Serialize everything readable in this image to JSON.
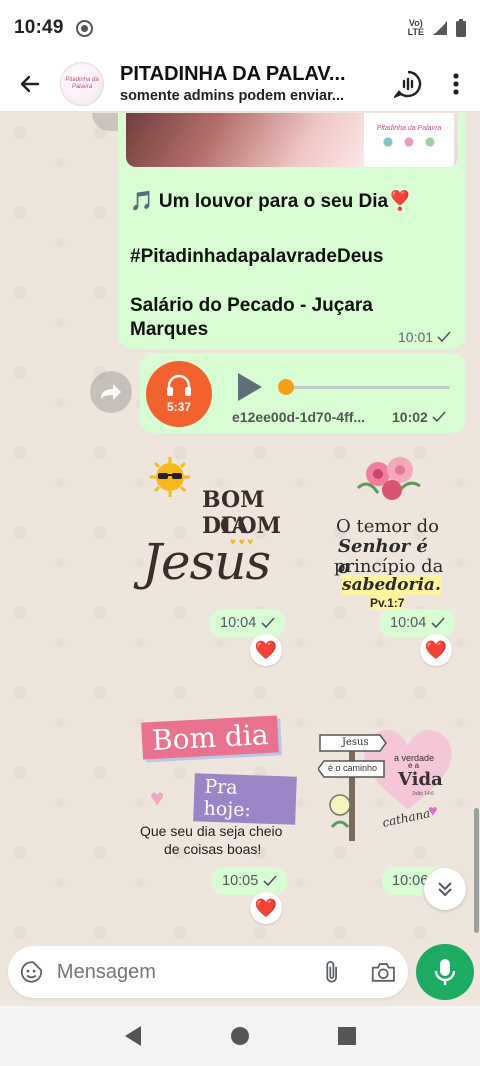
{
  "status_bar": {
    "time": "10:49",
    "volte_top": "Vo)",
    "volte_bottom": "LTE"
  },
  "header": {
    "title": "PITADINHA DA PALAV...",
    "subtitle": "somente admins podem enviar...",
    "avatar_text": "Pitadinha da Palavra"
  },
  "messages": {
    "image_card_text": "Pitadinha da Palavra",
    "text_line1": "🎵 Um louvor para o seu Dia❣️",
    "text_line2": "#PitadinhadapalavradeDeus",
    "text_line3": "Salário do Pecado - Juçara",
    "text_line4": "Marques",
    "text_time": "10:01",
    "audio_duration": "5:37",
    "audio_progress": 0.0,
    "audio_filename": "e12ee00d-1d70-4ff...",
    "audio_time": "10:02",
    "sticker1_line1": "BOM DIA",
    "sticker1_line2": "COM",
    "sticker1_line3": "Jesus",
    "sticker1_time": "10:04",
    "sticker2_line1": "O temor do",
    "sticker2_line2": "Senhor é o",
    "sticker2_line3": "princípio da",
    "sticker2_line4": "sabedoria.",
    "sticker2_line5": "Pv.1:7",
    "sticker2_time": "10:04",
    "sticker3_line1": "Bom dia",
    "sticker3_line2": "Pra hoje:",
    "sticker3_line3": "Que seu dia seja cheio",
    "sticker3_line4": "de coisas boas!",
    "sticker3_time": "10:05",
    "sticker4_sign1": "Jesus",
    "sticker4_sign2": "é o caminho",
    "sticker4_text1": "a verdade",
    "sticker4_text2": "e a",
    "sticker4_text3": "Vida",
    "sticker4_ref": "João 14:6",
    "sticker4_sig": "cathana",
    "sticker4_time": "10:06",
    "reaction": "❤️"
  },
  "composer": {
    "placeholder": "Mensagem"
  },
  "colors": {
    "bubble": "#d9fdd3",
    "accent": "#1daa61",
    "audio_avatar": "#f2622e",
    "progress_knob": "#f59f1a"
  }
}
